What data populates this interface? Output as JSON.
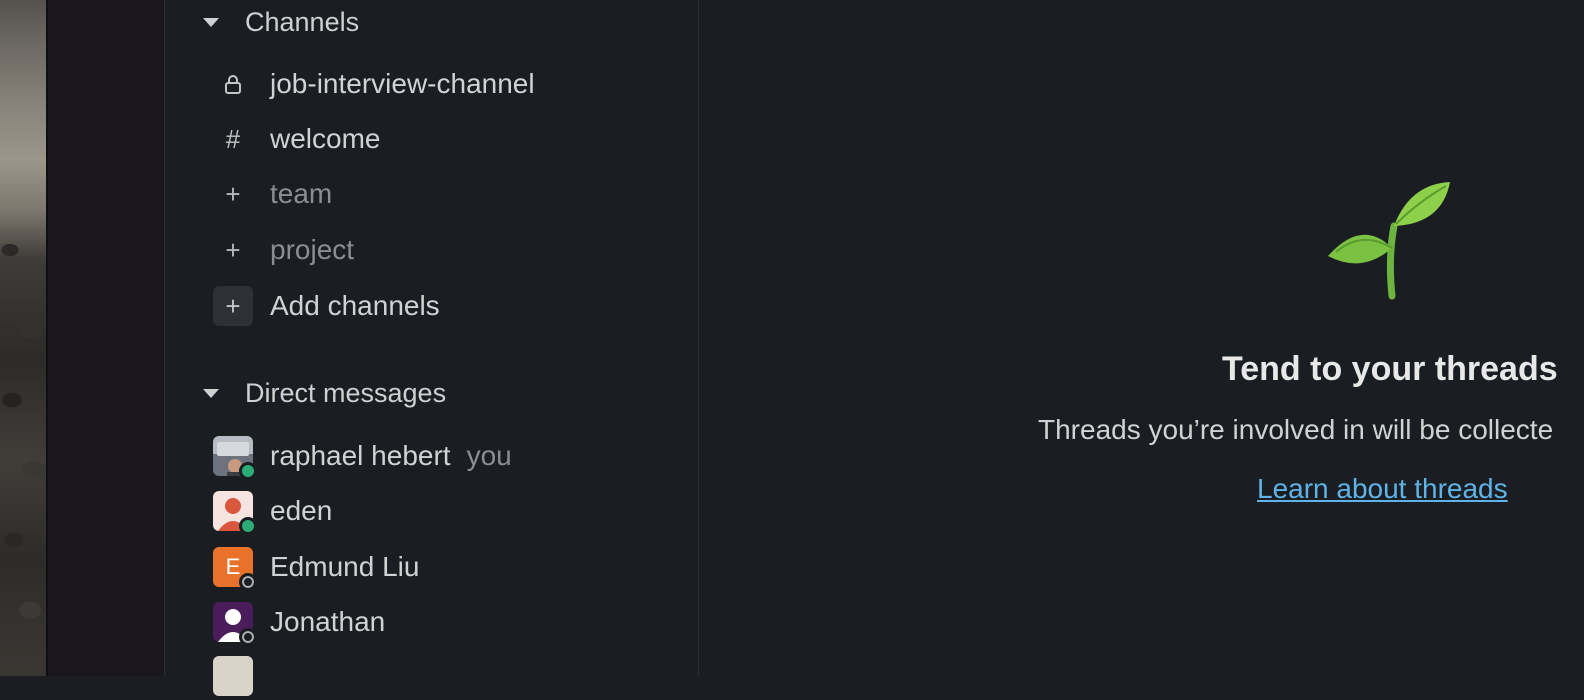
{
  "sidebar": {
    "channels_header": "Channels",
    "channels": [
      {
        "name": "job-interview-channel",
        "icon": "lock-icon"
      },
      {
        "name": "welcome",
        "icon": "hash-icon",
        "glyph": "#"
      },
      {
        "name": "team",
        "icon": "plus-icon",
        "glyph": "+"
      },
      {
        "name": "project",
        "icon": "plus-icon",
        "glyph": "+"
      }
    ],
    "add_channels": "Add channels",
    "dm_header": "Direct messages",
    "dms": [
      {
        "name": "raphael hebert",
        "tag": "you",
        "presence": "online"
      },
      {
        "name": "eden",
        "presence": "online"
      },
      {
        "name": "Edmund Liu",
        "initial": "E",
        "presence": "away"
      },
      {
        "name": "Jonathan",
        "presence": "away"
      }
    ]
  },
  "main": {
    "empty_title": "Tend to your threads",
    "empty_text": "Threads you’re involved in will be collecte",
    "learn_link": "Learn about threads"
  },
  "colors": {
    "background": "#1a1d21",
    "link": "#5fb3e6",
    "online": "#2bac76",
    "avatar_orange": "#e8722a",
    "avatar_purple": "#4a1d5a",
    "avatar_red": "#d9573c"
  }
}
